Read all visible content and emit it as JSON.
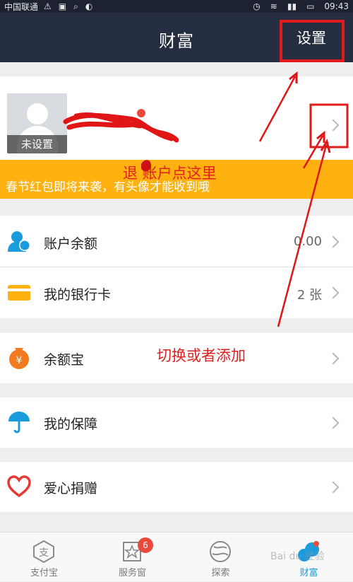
{
  "status_bar": {
    "carrier": "中国联通",
    "time": "09:43"
  },
  "nav": {
    "title": "财富",
    "settings_label": "设置"
  },
  "profile": {
    "avatar_label": "未设置"
  },
  "banner": {
    "text": "春节红包即将来袭，有头像才能收到哦"
  },
  "menu": {
    "balance": {
      "label": "账户余额",
      "value": "0.00"
    },
    "bank_card": {
      "label": "我的银行卡",
      "value": "2 张"
    },
    "yuebao": {
      "label": "余额宝"
    },
    "insurance": {
      "label": "我的保障"
    },
    "charity": {
      "label": "爱心捐赠"
    }
  },
  "tabs": [
    {
      "label": "支付宝",
      "icon": "alipay-icon"
    },
    {
      "label": "服务窗",
      "icon": "service-window-icon",
      "badge": "6"
    },
    {
      "label": "探索",
      "icon": "explore-icon"
    },
    {
      "label": "财富",
      "icon": "wealth-icon",
      "active": true
    }
  ],
  "annotations": {
    "logout_hint": "退  账户点这里",
    "switch_hint": "切换或者添加"
  },
  "watermark": "Bai du 经验",
  "colors": {
    "nav_bg": "#252d40",
    "banner": "#ffb20f",
    "annotation_red": "#e02020",
    "accent_blue": "#1a9bdb"
  }
}
